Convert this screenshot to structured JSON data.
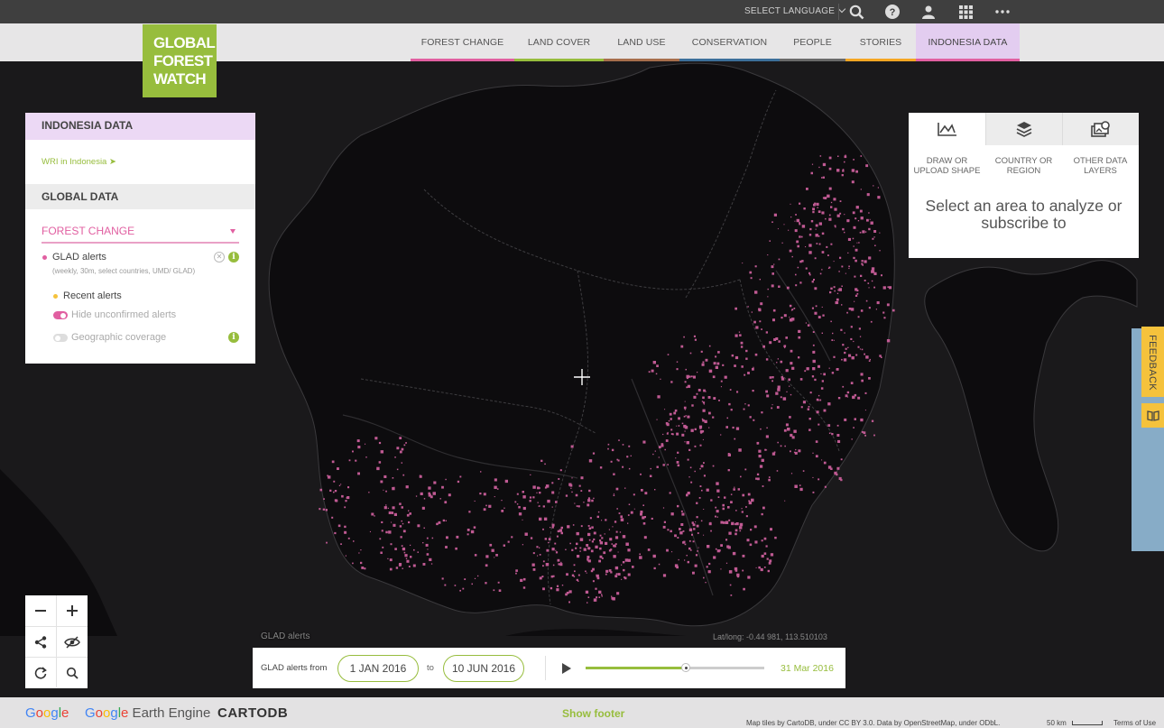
{
  "topbar": {
    "language_label": "SELECT LANGUAGE",
    "icons": [
      "search-icon",
      "help-icon",
      "user-icon",
      "apps-grid-icon",
      "more-icon"
    ]
  },
  "logo": {
    "line1": "GLOBAL",
    "line2": "FOREST",
    "line3": "WATCH"
  },
  "nav": {
    "items": [
      {
        "label": "FOREST CHANGE",
        "color": "#e15fa1"
      },
      {
        "label": "LAND COVER",
        "color": "#97bd3d"
      },
      {
        "label": "LAND USE",
        "color": "#a76e4c"
      },
      {
        "label": "CONSERVATION",
        "color": "#3c6f9a"
      },
      {
        "label": "PEOPLE",
        "color": "#6a6a6a"
      },
      {
        "label": "STORIES",
        "color": "#f5a623"
      },
      {
        "label": "INDONESIA DATA",
        "color": "#e15fa1"
      }
    ]
  },
  "left_panel": {
    "indonesia_header": "INDONESIA DATA",
    "wri_link": "WRI in Indonesia ➤",
    "global_header": "GLOBAL DATA",
    "category": "FOREST CHANGE",
    "layer_name": "GLAD alerts",
    "layer_sub": "(weekly, 30m, select countries, UMD/ GLAD)",
    "recent_alerts": "Recent alerts",
    "hide_unconfirmed": "Hide unconfirmed alerts",
    "geographic_coverage": "Geographic coverage",
    "hide_unconfirmed_on": true,
    "geographic_coverage_on": false
  },
  "right_panel": {
    "tabs": [
      {
        "label": "DRAW OR UPLOAD SHAPE",
        "icon": "draw-shape-icon"
      },
      {
        "label": "COUNTRY OR REGION",
        "icon": "layers-icon"
      },
      {
        "label": "OTHER DATA LAYERS",
        "icon": "data-layers-icon"
      }
    ],
    "prompt": "Select an area to analyze or subscribe to"
  },
  "feedback_label": "FEEDBACK",
  "map": {
    "layer_label": "GLAD alerts",
    "latlng": "Lat/long: -0.44 981, 113.510103"
  },
  "timeline": {
    "label": "GLAD alerts from",
    "from_date": "1 JAN 2016",
    "to_label": "to",
    "to_date": "10 JUN 2016",
    "current_date": "31 Mar 2016",
    "progress": 0.56
  },
  "footer": {
    "google": "Google",
    "earth_engine": "Google Earth Engine",
    "cartodb": "CARTODB",
    "show_footer": "Show footer",
    "attribution": "Map tiles by CartoDB, under CC BY 3.0. Data by OpenStreetMap, under ODbL.",
    "scale": "50 km",
    "terms": "Terms of Use"
  },
  "colors": {
    "brand_green": "#97bd3d",
    "alert_pink": "#c05a93",
    "recent_yellow": "#f5c23c"
  }
}
